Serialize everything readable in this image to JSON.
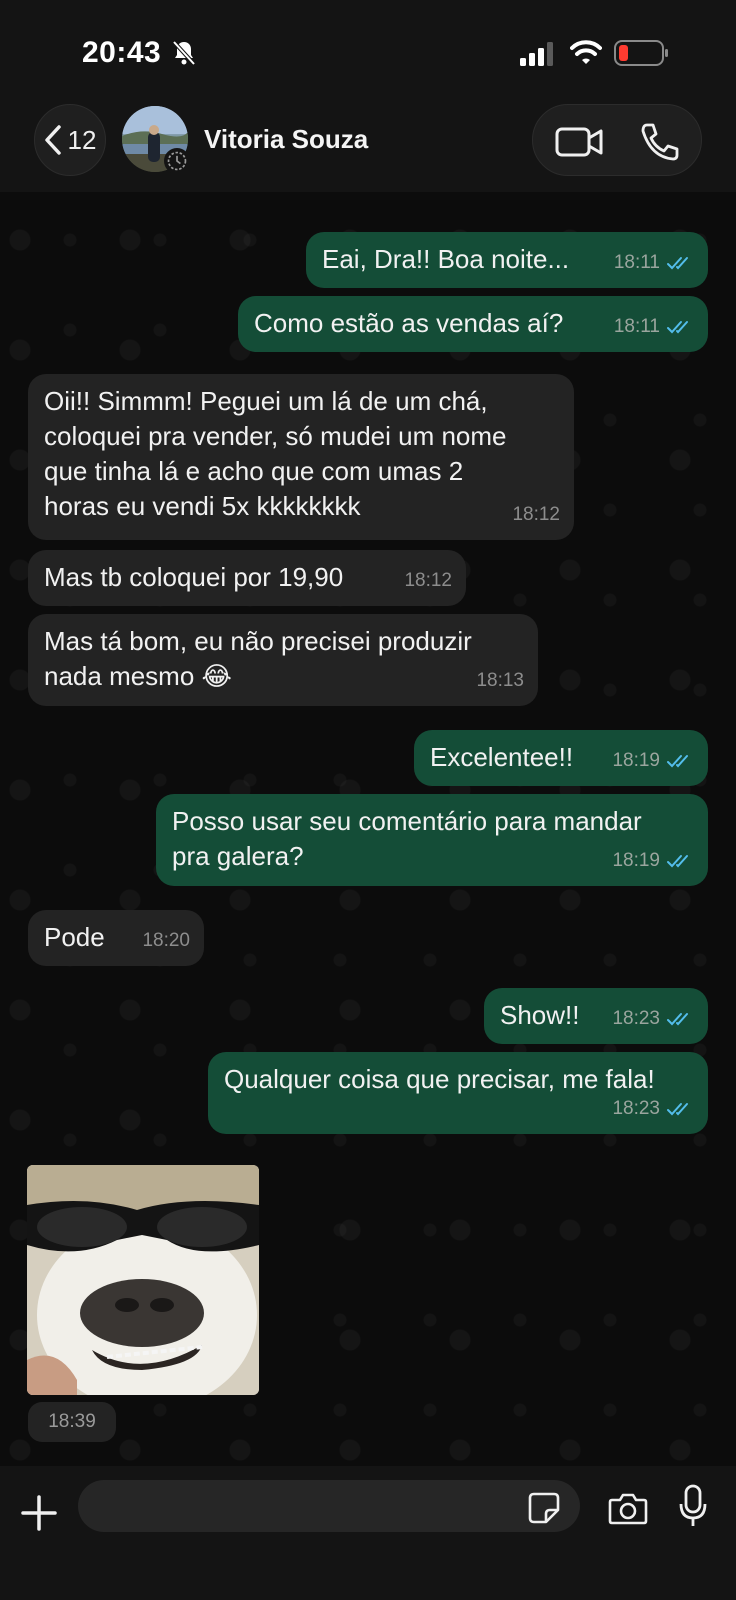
{
  "status_bar": {
    "time": "20:43"
  },
  "header": {
    "back_count": "12",
    "contact_name": "Vitoria Souza"
  },
  "messages": [
    {
      "dir": "out",
      "text": "Eai, Dra!! Boa noite...",
      "time": "18:11"
    },
    {
      "dir": "out",
      "text": "Como estão as vendas aí?",
      "time": "18:11"
    },
    {
      "dir": "in",
      "text": "Oii!! Simmm! Peguei um lá de um chá,\ncoloquei pra vender, só mudei um nome\nque tinha lá e acho que com umas 2\nhoras eu vendi 5x kkkkkkkk",
      "time": "18:12"
    },
    {
      "dir": "in",
      "text": "Mas tb coloquei por 19,90",
      "time": "18:12"
    },
    {
      "dir": "in",
      "text": "Mas tá bom, eu não precisei produzir\nnada mesmo 😂",
      "time": "18:13"
    },
    {
      "dir": "out",
      "text": "Excelentee!!",
      "time": "18:19"
    },
    {
      "dir": "out",
      "text": "Posso usar seu comentário para mandar\npra galera?",
      "time": "18:19"
    },
    {
      "dir": "in",
      "text": "Pode",
      "time": "18:20"
    },
    {
      "dir": "out",
      "text": "Show!!",
      "time": "18:23"
    },
    {
      "dir": "out",
      "text": "Qualquer coisa que precisar, me fala!",
      "time": "18:23"
    }
  ],
  "sticker": {
    "time": "18:39"
  },
  "input": {
    "placeholder": ""
  },
  "colors": {
    "outgoing_bubble": "#144d37",
    "incoming_bubble": "#232323",
    "read_ticks": "#53bdeb"
  }
}
